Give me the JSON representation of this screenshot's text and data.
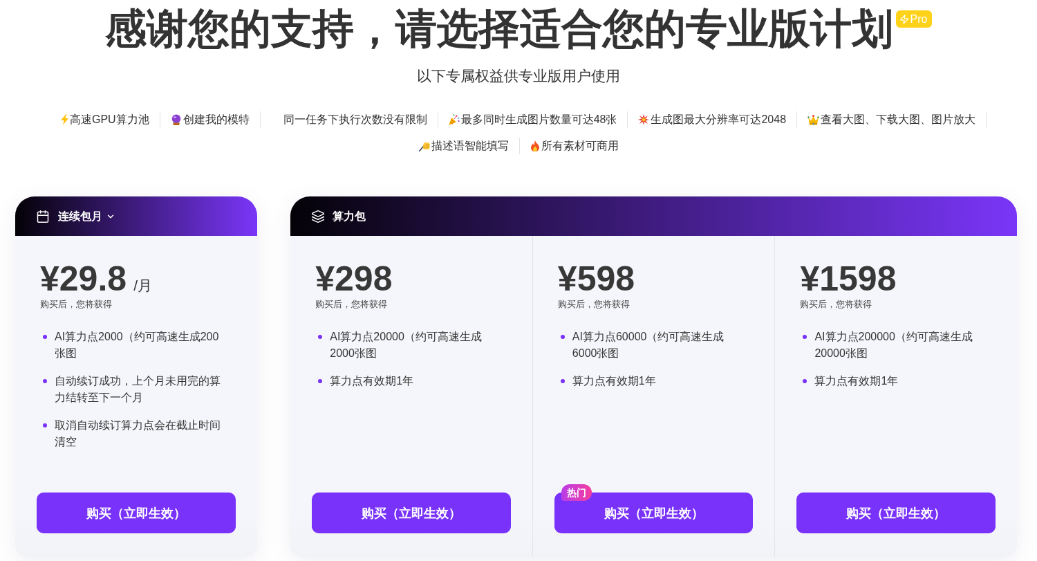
{
  "header": {
    "title": "感谢您的支持，请选择适合您的专业版计划",
    "badge": "Pro",
    "subtitle": "以下专属权益供专业版用户使用"
  },
  "features": [
    "高速GPU算力池",
    "创建我的模特",
    "同一任务下执行次数没有限制",
    "最多同时生成图片数量可达48张",
    "生成图最大分辨率可达2048",
    "查看大图、下载大图、图片放大",
    "描述语智能填写",
    "所有素材可商用"
  ],
  "cards": [
    {
      "kind": "monthly",
      "label": "连续包月",
      "plans": [
        {
          "price": "¥29.8",
          "unit": "/月",
          "note": "购买后，您将获得",
          "benefits": [
            "AI算力点2000（约可高速生成200张图",
            "自动续订成功，上个月未用完的算力结转至下一个月",
            "取消自动续订算力点会在截止时间清空"
          ],
          "button": "购买（立即生效）"
        }
      ]
    },
    {
      "kind": "pack",
      "label": "算力包",
      "plans": [
        {
          "price": "¥298",
          "note": "购买后，您将获得",
          "benefits": [
            "AI算力点20000（约可高速生成2000张图",
            "算力点有效期1年"
          ],
          "button": "购买（立即生效）"
        },
        {
          "price": "¥598",
          "note": "购买后，您将获得",
          "benefits": [
            "AI算力点60000（约可高速生成6000张图",
            "算力点有效期1年"
          ],
          "button": "购买（立即生效）",
          "badge": "热门"
        },
        {
          "price": "¥1598",
          "note": "购买后，您将获得",
          "benefits": [
            "AI算力点200000（约可高速生成20000张图",
            "算力点有效期1年"
          ],
          "button": "购买（立即生效）"
        }
      ]
    }
  ]
}
